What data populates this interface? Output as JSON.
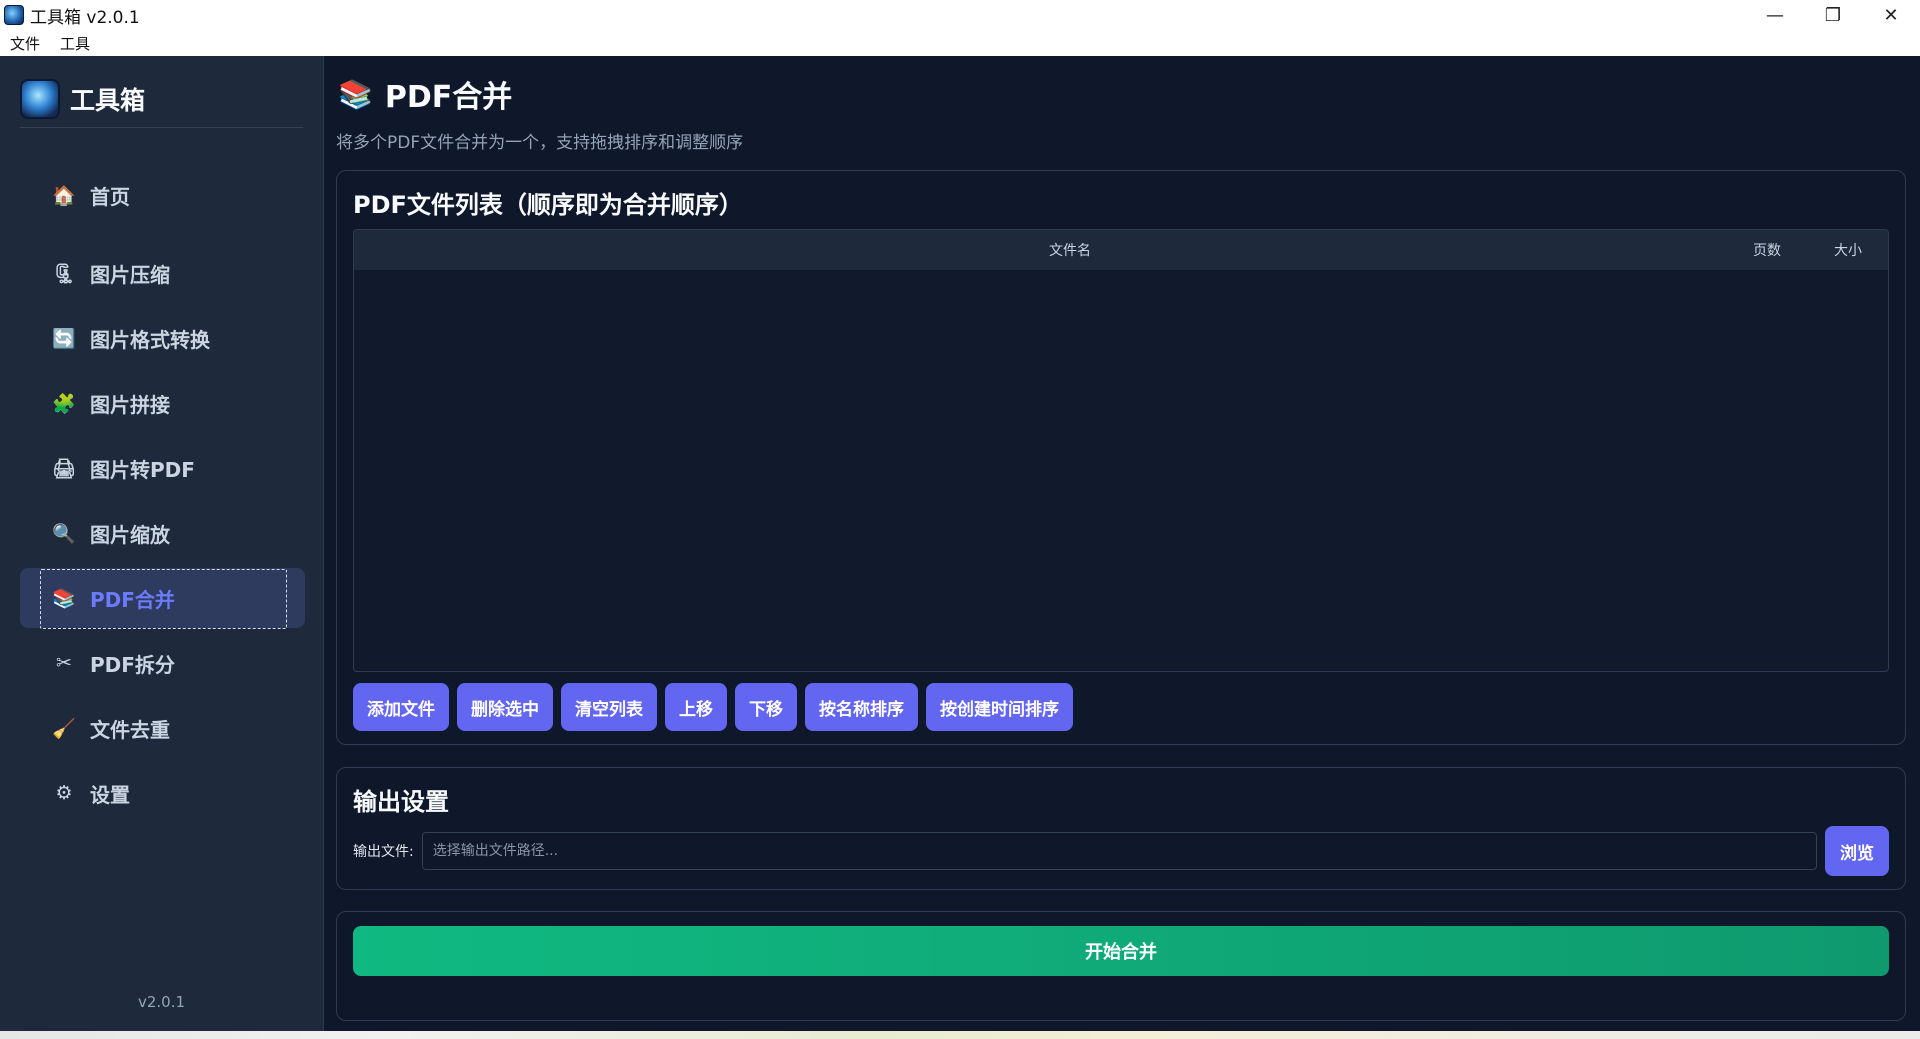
{
  "window": {
    "title": "工具箱 v2.0.1",
    "controls": {
      "minimize": "—",
      "maximize": "❐",
      "close": "✕"
    }
  },
  "menu": [
    "文件",
    "工具"
  ],
  "sidebar": {
    "brand": "工具箱",
    "items": [
      {
        "label": "首页",
        "icon": "home-icon",
        "glyph": "🏠"
      },
      {
        "label": "图片压缩",
        "icon": "compress-icon",
        "glyph": "🗜"
      },
      {
        "label": "图片格式转换",
        "icon": "convert-icon",
        "glyph": "🔄"
      },
      {
        "label": "图片拼接",
        "icon": "puzzle-icon",
        "glyph": "🧩"
      },
      {
        "label": "图片转PDF",
        "icon": "printer-icon",
        "glyph": "🖨"
      },
      {
        "label": "图片缩放",
        "icon": "magnifier-icon",
        "glyph": "🔍"
      },
      {
        "label": "PDF合并",
        "icon": "books-icon",
        "glyph": "📚"
      },
      {
        "label": "PDF拆分",
        "icon": "scissors-icon",
        "glyph": "✂"
      },
      {
        "label": "文件去重",
        "icon": "broom-icon",
        "glyph": "🧹"
      },
      {
        "label": "设置",
        "icon": "gear-icon",
        "glyph": "⚙"
      }
    ],
    "active_index": 6,
    "version": "v2.0.1"
  },
  "main": {
    "title": "PDF合并",
    "title_glyph": "📚",
    "description": "将多个PDF文件合并为一个，支持拖拽排序和调整顺序",
    "file_list": {
      "title": "PDF文件列表（顺序即为合并顺序）",
      "columns": [
        "文件名",
        "页数",
        "大小"
      ],
      "rows": [],
      "buttons": [
        "添加文件",
        "删除选中",
        "清空列表",
        "上移",
        "下移",
        "按名称排序",
        "按创建时间排序"
      ]
    },
    "output": {
      "title": "输出设置",
      "label": "输出文件:",
      "placeholder": "选择输出文件路径...",
      "value": "",
      "browse": "浏览"
    },
    "start_button": "开始合并"
  },
  "colors": {
    "accent": "#6366f1",
    "success": "#10b981",
    "background": "#0f172a",
    "sidebar": "#1e293b"
  }
}
